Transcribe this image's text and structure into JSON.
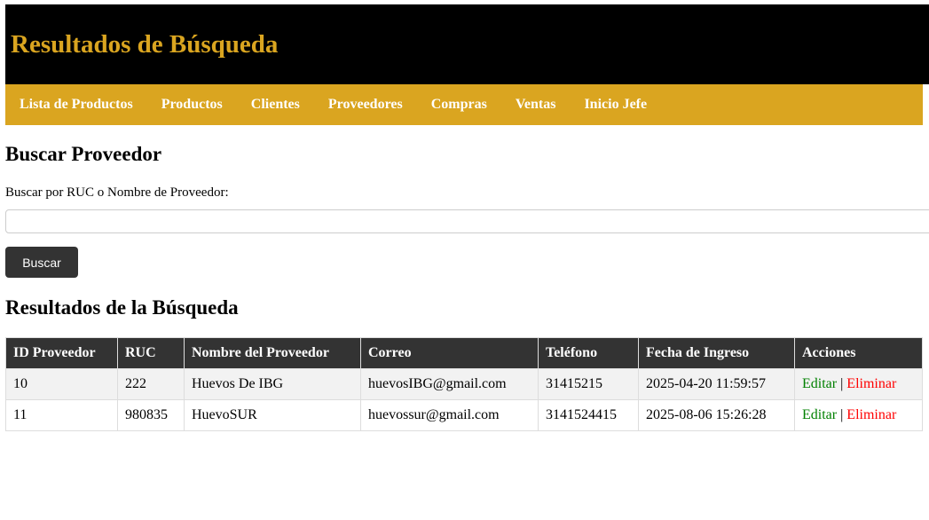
{
  "header": {
    "title": "Resultados de Búsqueda"
  },
  "nav": {
    "items": [
      {
        "label": "Lista de Productos"
      },
      {
        "label": "Productos"
      },
      {
        "label": "Clientes"
      },
      {
        "label": "Proveedores"
      },
      {
        "label": "Compras"
      },
      {
        "label": "Ventas"
      },
      {
        "label": "Inicio Jefe"
      }
    ]
  },
  "search": {
    "heading": "Buscar Proveedor",
    "label": "Buscar por RUC o Nombre de Proveedor:",
    "value": "",
    "button_label": "Buscar"
  },
  "results": {
    "heading": "Resultados de la Búsqueda",
    "columns": [
      "ID Proveedor",
      "RUC",
      "Nombre del Proveedor",
      "Correo",
      "Teléfono",
      "Fecha de Ingreso",
      "Acciones"
    ],
    "rows": [
      {
        "id": "10",
        "ruc": "222",
        "nombre": "Huevos De IBG",
        "correo": "huevosIBG@gmail.com",
        "telefono": "31415215",
        "fecha": "2025-04-20 11:59:57",
        "edit_label": "Editar",
        "separator": "|",
        "delete_label": "Eliminar"
      },
      {
        "id": "11",
        "ruc": "980835",
        "nombre": "HuevoSUR",
        "correo": "huevossur@gmail.com",
        "telefono": "3141524415",
        "fecha": "2025-08-06 15:26:28",
        "edit_label": "Editar",
        "separator": "|",
        "delete_label": "Eliminar"
      }
    ]
  },
  "colors": {
    "header_bg": "#000000",
    "accent_gold": "#daa520",
    "button_dark": "#333333",
    "edit_green": "#008000",
    "delete_red": "#ff0000"
  }
}
